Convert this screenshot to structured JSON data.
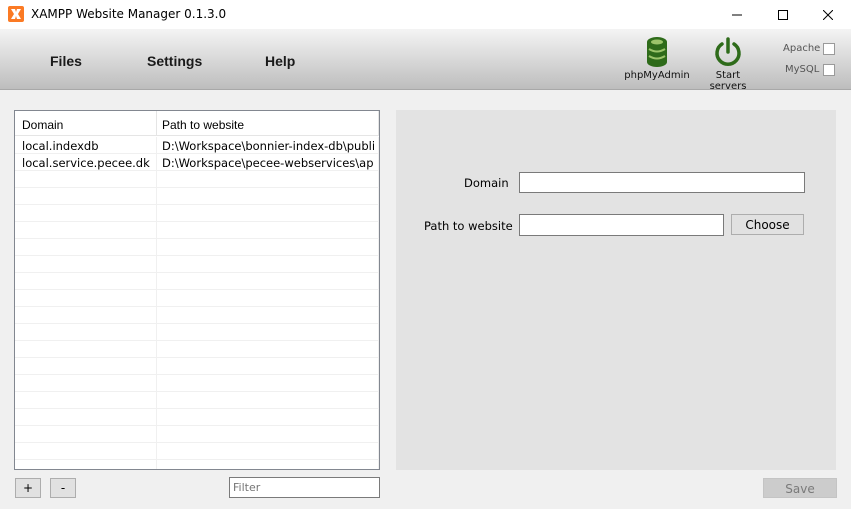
{
  "window": {
    "title": "XAMPP Website Manager 0.1.3.0"
  },
  "menu": {
    "files": "Files",
    "settings": "Settings",
    "help": "Help"
  },
  "toolbar": {
    "phpmyadmin_label": "phpMyAdmin",
    "start_servers_label": "Start servers",
    "icon_color": "#2e6b1a"
  },
  "servers": {
    "apache_label": "Apache",
    "apache_checked": false,
    "mysql_label": "MySQL",
    "mysql_checked": false
  },
  "list": {
    "columns": [
      "Domain",
      "Path to website"
    ],
    "rows": [
      {
        "domain": "local.indexdb",
        "path": "D:\\Workspace\\bonnier-index-db\\public"
      },
      {
        "domain": "local.service.pecee.dk",
        "path": "D:\\Workspace\\pecee-webservices\\app\\..."
      }
    ],
    "add_label": "+",
    "remove_label": "-",
    "filter_placeholder": "Filter"
  },
  "form": {
    "domain_label": "Domain",
    "domain_value": "",
    "path_label": "Path to website",
    "path_value": "",
    "choose_label": "Choose",
    "save_label": "Save"
  }
}
